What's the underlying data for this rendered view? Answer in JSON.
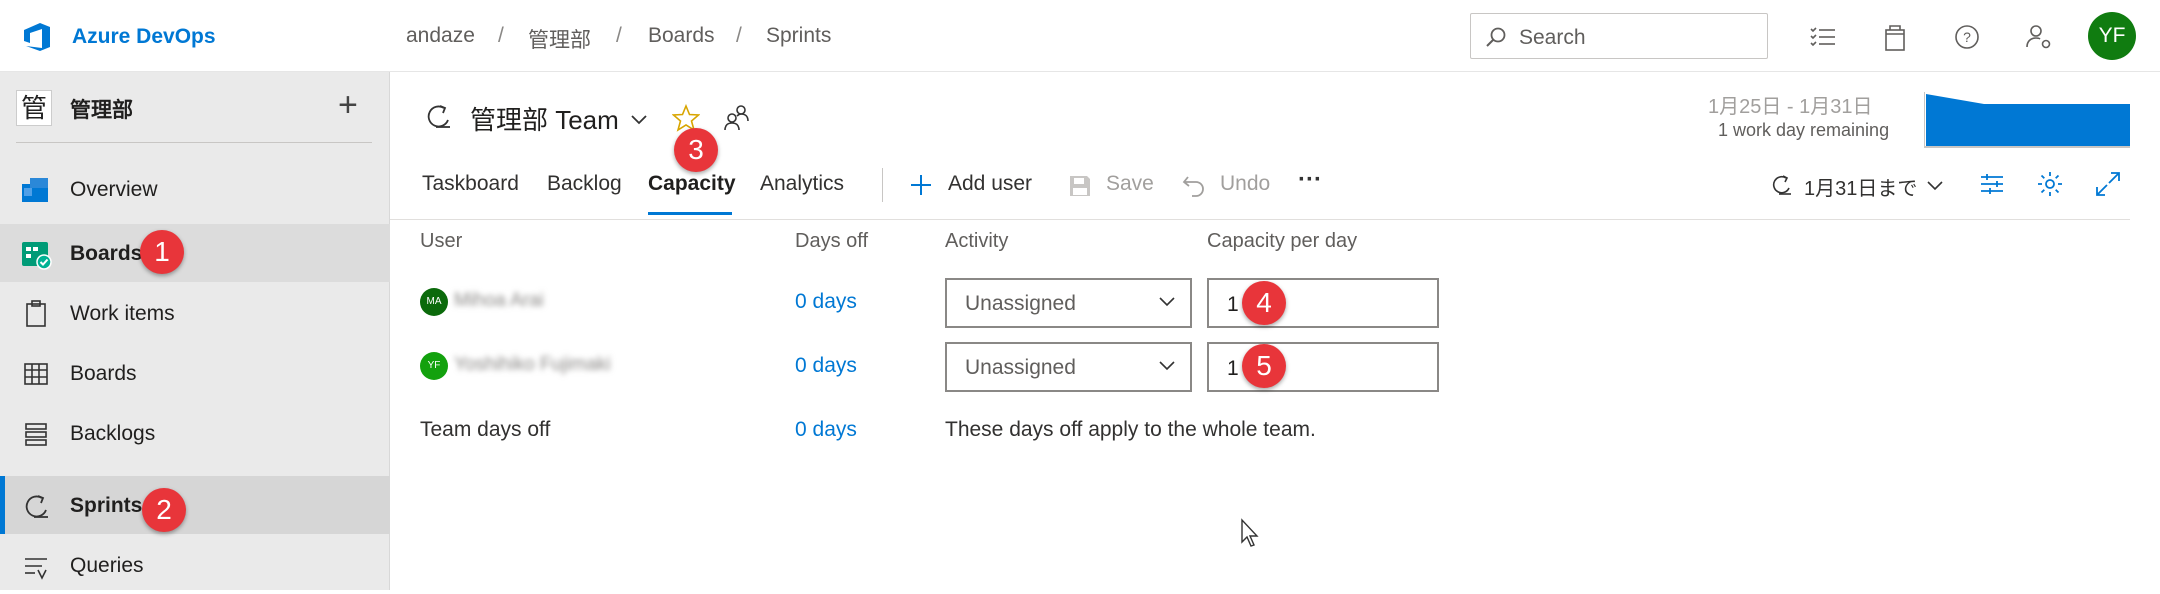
{
  "header": {
    "brand": "Azure DevOps",
    "breadcrumb": [
      "andaze",
      "管理部",
      "Boards",
      "Sprints"
    ],
    "search_placeholder": "Search",
    "avatar_initials": "YF"
  },
  "sidebar": {
    "project_icon_char": "管",
    "project_name": "管理部",
    "items": [
      {
        "label": "Overview",
        "icon": "overview-icon"
      },
      {
        "label": "Boards",
        "icon": "boards-hub-icon",
        "badge": "1"
      },
      {
        "label": "Work items",
        "icon": "work-items-icon"
      },
      {
        "label": "Boards",
        "icon": "boards-icon"
      },
      {
        "label": "Backlogs",
        "icon": "backlogs-icon"
      },
      {
        "label": "Sprints",
        "icon": "sprints-icon",
        "badge": "2",
        "selected": true
      },
      {
        "label": "Queries",
        "icon": "queries-icon"
      }
    ]
  },
  "main": {
    "team_name": "管理部 Team",
    "star_badge": "3",
    "tabs": [
      "Taskboard",
      "Backlog",
      "Capacity",
      "Analytics"
    ],
    "active_tab": "Capacity",
    "toolbar": {
      "add_user": "Add user",
      "save": "Save",
      "undo": "Undo",
      "more": "···"
    },
    "sprint": {
      "dates": "1月25日 - 1月31日",
      "remaining": "1 work day remaining",
      "selector": "1月31日まで"
    },
    "table": {
      "headers": [
        "User",
        "Days off",
        "Activity",
        "Capacity per day"
      ],
      "rows": [
        {
          "initials": "MA",
          "avatar_color": "#0b6a0b",
          "name": "Mihoa Arai",
          "days_off": "0 days",
          "activity": "Unassigned",
          "capacity": "1",
          "badge": "4"
        },
        {
          "initials": "YF",
          "avatar_color": "#13a10e",
          "name": "Yoshihiko Fujimaki",
          "days_off": "0 days",
          "activity": "Unassigned",
          "capacity": "1",
          "badge": "5"
        }
      ],
      "team_days_off_label": "Team days off",
      "team_days_off_value": "0 days",
      "team_days_note": "These days off apply to the whole team."
    }
  },
  "colors": {
    "accent": "#0078d4",
    "badge": "#e8353a",
    "avatar": "#107c10"
  }
}
